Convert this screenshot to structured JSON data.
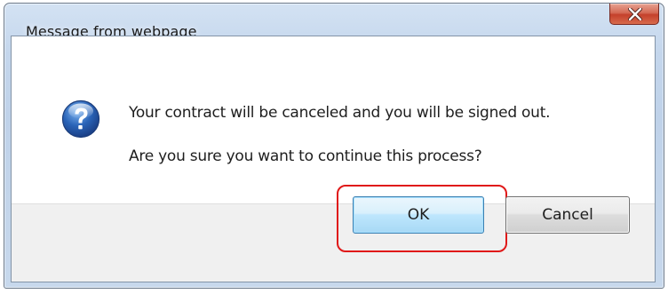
{
  "dialog": {
    "title": "Message from webpage",
    "icon": "question-icon",
    "message_line1": "Your contract will be canceled and you will be signed out.",
    "message_line2": "Are you sure you want to continue this process?",
    "ok_label": "OK",
    "cancel_label": "Cancel",
    "close_icon": "close-icon"
  },
  "colors": {
    "highlight": "#e01919",
    "ok_border": "#3c7fb1",
    "icon_blue": "#2a64b8",
    "close_red": "#c4402b"
  }
}
